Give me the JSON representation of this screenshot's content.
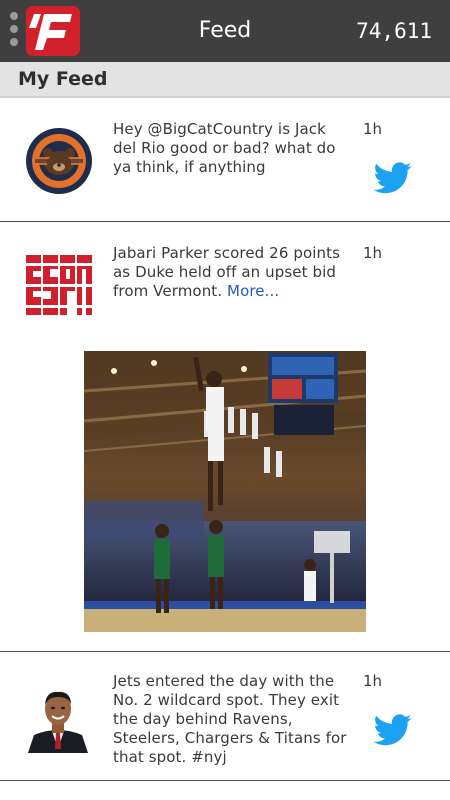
{
  "header": {
    "title": "Feed",
    "score": "74,611",
    "logo_letter": "F"
  },
  "section": {
    "label": "My Feed"
  },
  "feed": [
    {
      "text": "Hey @BigCatCountry is Jack del Rio good or bad? what do ya think, if anything",
      "time": "1h",
      "source": "twitter",
      "avatar": "bears-logo"
    },
    {
      "text": "Jabari Parker scored 26 points as Duke held off an upset bid from Vermont.",
      "more": "More...",
      "time": "1h",
      "source": "espn",
      "avatar": "espn-logo",
      "image": "basketball-photo"
    },
    {
      "text": "Jets entered the day with the No. 2 wildcard spot. They exit the day behind Ravens, Steelers, Chargers & Titans for that spot. #nyj",
      "time": "1h",
      "source": "twitter",
      "avatar": "reporter-photo"
    }
  ],
  "colors": {
    "topbar": "#3f3f3f",
    "logo_red": "#d3212b",
    "twitter_blue": "#1da1f2",
    "link_blue": "#1e5bbf",
    "section_bg": "#e3e3e3"
  }
}
